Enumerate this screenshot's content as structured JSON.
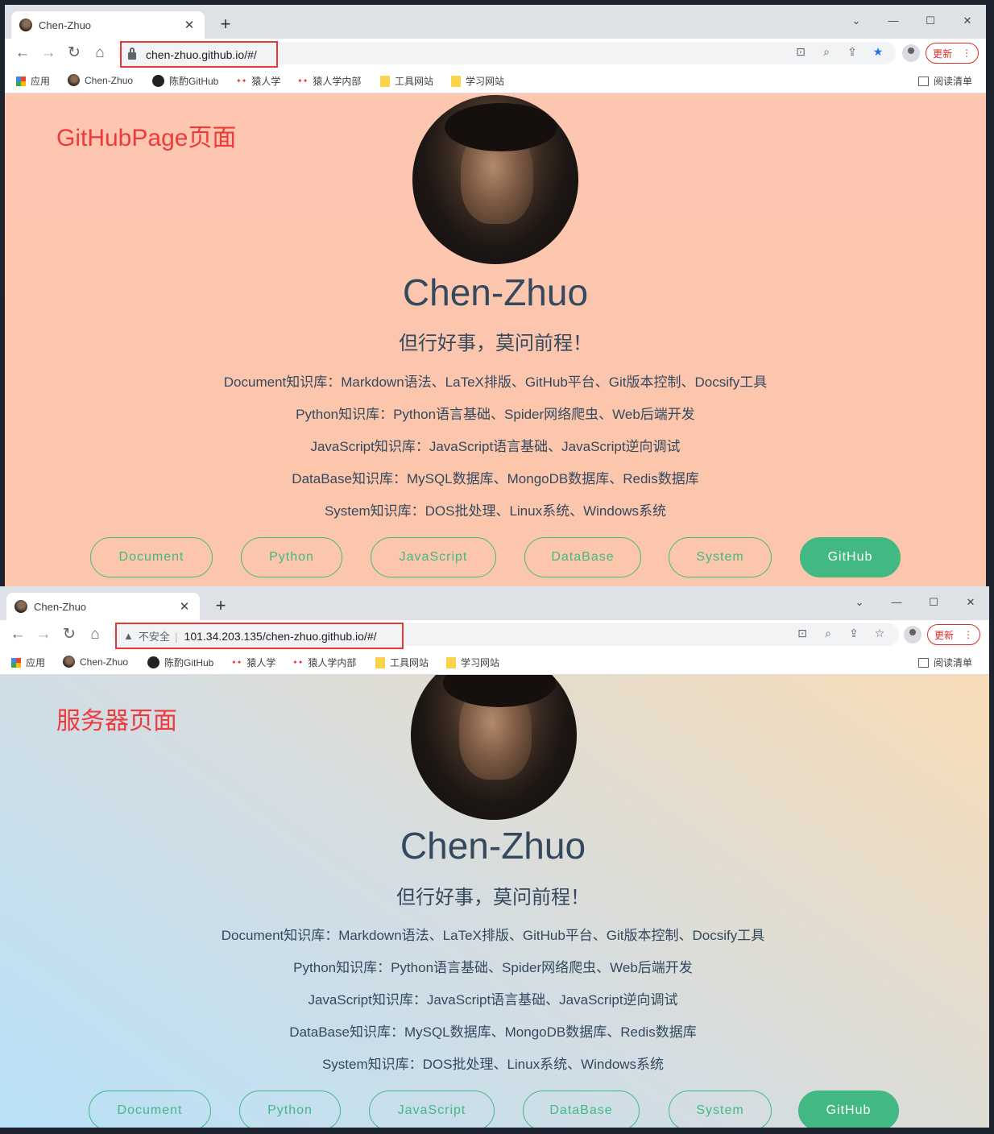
{
  "windows": [
    {
      "tab_title": "Chen-Zhuo",
      "address_url": "chen-zhuo.github.io/#/",
      "insecure_label": "",
      "annotation": "GitHubPage页面",
      "update_label": "更新"
    },
    {
      "tab_title": "Chen-Zhuo",
      "address_url": "101.34.203.135/chen-zhuo.github.io/#/",
      "insecure_label": "不安全",
      "annotation": "服务器页面",
      "update_label": "更新"
    }
  ],
  "bookmarks": {
    "apps": "应用",
    "chen_zhuo": "Chen-Zhuo",
    "chen_github": "陈酌GitHub",
    "yuanrenxue": "猿人学",
    "yuanrenxue_inner": "猿人学内部",
    "tool_sites": "工具网站",
    "study_sites": "学习网站",
    "reading_list": "阅读清单"
  },
  "site": {
    "name": "Chen-Zhuo",
    "motto": "但行好事，莫问前程！",
    "lines": [
      "Document知识库：Markdown语法、LaTeX排版、GitHub平台、Git版本控制、Docsify工具",
      "Python知识库：Python语言基础、Spider网络爬虫、Web后端开发",
      "JavaScript知识库：JavaScript语言基础、JavaScript逆向调试",
      "DataBase知识库：MySQL数据库、MongoDB数据库、Redis数据库",
      "System知识库：DOS批处理、Linux系统、Windows系统"
    ],
    "buttons": [
      "Document",
      "Python",
      "JavaScript",
      "DataBase",
      "System",
      "GitHub"
    ]
  },
  "colors": {
    "accent": "#42b983",
    "text": "#34495e",
    "annotation": "#f03a3a",
    "highlight_box": "#e53935"
  },
  "icons": {
    "back": "arrow-left-icon",
    "forward": "arrow-right-icon",
    "reload": "reload-icon",
    "home": "home-icon",
    "translate": "translate-icon",
    "zoom": "zoom-icon",
    "share": "share-icon",
    "bookmark": "star-icon"
  }
}
